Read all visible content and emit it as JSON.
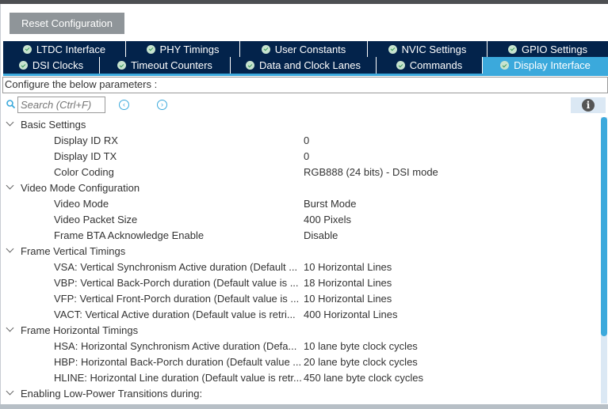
{
  "toolbar": {
    "reset_label": "Reset Configuration"
  },
  "tabs_row1": [
    {
      "label": "LTDC Interface"
    },
    {
      "label": "PHY Timings"
    },
    {
      "label": "User Constants"
    },
    {
      "label": "NVIC Settings"
    },
    {
      "label": "GPIO Settings"
    }
  ],
  "tabs_row2": [
    {
      "label": "DSI Clocks"
    },
    {
      "label": "Timeout Counters"
    },
    {
      "label": "Data and Clock Lanes"
    },
    {
      "label": "Commands"
    },
    {
      "label": "Display Interface",
      "active": true
    }
  ],
  "configure_text": "Configure the below parameters :",
  "search": {
    "placeholder": "Search (Ctrl+F)"
  },
  "tree": [
    {
      "group": "Basic Settings",
      "items": [
        {
          "label": "Display ID RX",
          "value": "0"
        },
        {
          "label": "Display ID TX",
          "value": "0"
        },
        {
          "label": "Color Coding",
          "value": "RGB888 (24 bits) - DSI mode"
        }
      ]
    },
    {
      "group": "Video Mode Configuration",
      "items": [
        {
          "label": "Video Mode",
          "value": "Burst Mode"
        },
        {
          "label": "Video Packet Size",
          "value": "400 Pixels"
        },
        {
          "label": "Frame BTA Acknowledge Enable",
          "value": "Disable"
        }
      ]
    },
    {
      "group": "Frame Vertical Timings",
      "items": [
        {
          "label": "VSA: Vertical Synchronism Active duration (Default ...",
          "value": "10 Horizontal Lines"
        },
        {
          "label": "VBP: Vertical Back-Porch duration (Default value is ...",
          "value": "18 Horizontal Lines"
        },
        {
          "label": "VFP: Vertical Front-Porch duration (Default value is ...",
          "value": "10 Horizontal Lines"
        },
        {
          "label": "VACT: Vertical Active duration (Default value is retri...",
          "value": "400 Horizontal Lines"
        }
      ]
    },
    {
      "group": "Frame Horizontal Timings",
      "items": [
        {
          "label": "HSA: Horizontal Synchronism Active duration (Defa...",
          "value": "10 lane byte clock cycles"
        },
        {
          "label": "HBP: Horizontal Back-Porch duration (Default value ...",
          "value": "20 lane byte clock cycles"
        },
        {
          "label": "HLINE: Horizontal Line duration (Default value is retr...",
          "value": "450 lane byte clock cycles"
        }
      ]
    },
    {
      "group": "Enabling Low-Power Transitions during:",
      "items": []
    }
  ]
}
